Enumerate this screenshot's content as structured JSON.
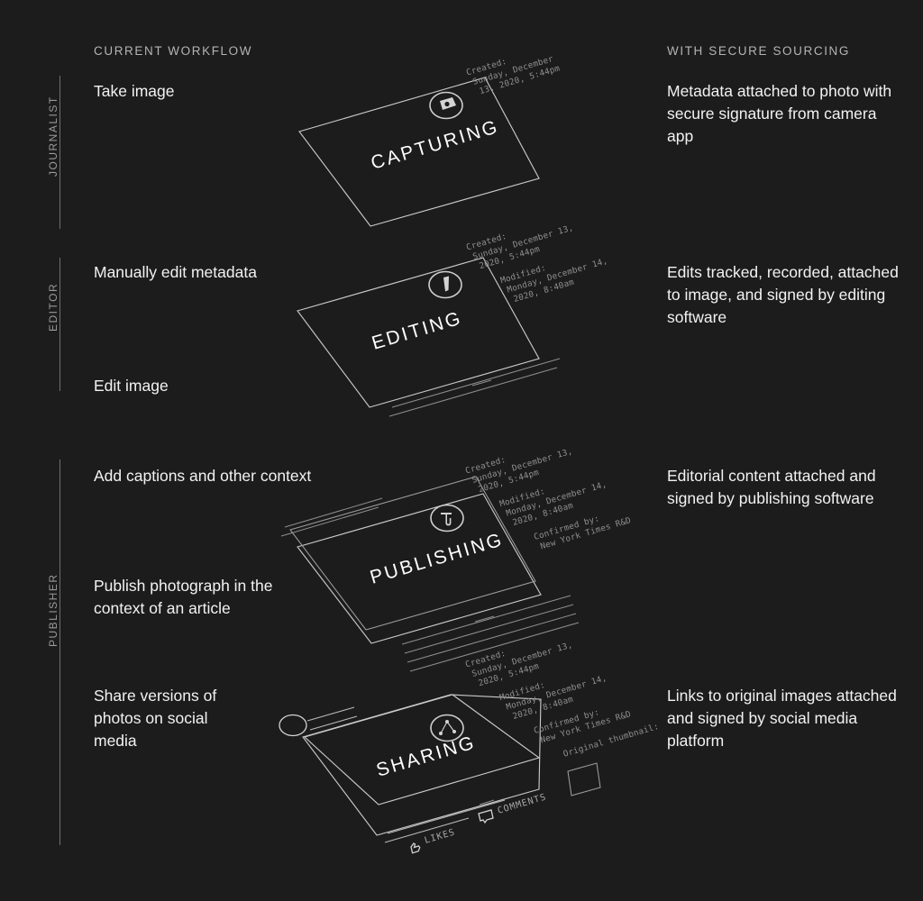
{
  "background_color": "#1c1c1c",
  "columns": {
    "left_header": "CURRENT WORKFLOW",
    "right_header": "WITH SECURE SOURCING"
  },
  "roles": [
    {
      "label": "JOURNALIST"
    },
    {
      "label": "EDITOR"
    },
    {
      "label": "PUBLISHER"
    }
  ],
  "steps": [
    {
      "id": "capturing",
      "stage_label": "CAPTURING",
      "icon": "camera-icon",
      "left_text": "Take image",
      "right_text": "Metadata attached to photo with secure signature from camera app",
      "metadata": [
        {
          "label": "Created:",
          "lines": [
            "Sunday, December",
            "13, 2020, 5:44pm"
          ]
        }
      ]
    },
    {
      "id": "editing",
      "stage_label": "EDITING",
      "icon": "edit-pen-icon",
      "left_text": "Manually edit metadata",
      "left_text_secondary": "Edit image",
      "right_text": "Edits tracked, recorded, attached to image, and signed by editing software",
      "metadata": [
        {
          "label": "Created:",
          "lines": [
            "Sunday, December 13,",
            "2020, 5:44pm"
          ]
        },
        {
          "label": "Modified:",
          "lines": [
            "Monday, December 14,",
            "2020, 8:40am"
          ]
        }
      ]
    },
    {
      "id": "publishing",
      "stage_label": "PUBLISHING",
      "icon": "nyt-t-logo-icon",
      "left_text": "Add captions and other context",
      "left_text_secondary": "Publish photograph in the context of an article",
      "right_text": "Editorial content attached and signed by publishing software",
      "metadata": [
        {
          "label": "Created:",
          "lines": [
            "Sunday, December 13,",
            "2020, 5:44pm"
          ]
        },
        {
          "label": "Modified:",
          "lines": [
            "Monday, December 14,",
            "2020, 8:40am"
          ]
        },
        {
          "label": "Confirmed by:",
          "lines": [
            "New York Times R&D"
          ]
        }
      ]
    },
    {
      "id": "sharing",
      "stage_label": "SHARING",
      "icon": "share-network-icon",
      "left_text": "Share versions of photos on social media",
      "right_text": "Links to original images attached and signed by social media platform",
      "metadata": [
        {
          "label": "Created:",
          "lines": [
            "Sunday, December 13,",
            "2020, 5:44pm"
          ]
        },
        {
          "label": "Modified:",
          "lines": [
            "Monday, December 14,",
            "2020, 8:40am"
          ]
        },
        {
          "label": "Confirmed by:",
          "lines": [
            "New York Times R&D"
          ]
        },
        {
          "label": "Original thumbnail:",
          "lines": []
        }
      ],
      "social": {
        "likes_label": "LIKES",
        "likes_icon": "thumbs-up-icon",
        "comments_label": "COMMENTS",
        "comments_icon": "comment-bubble-icon",
        "avatar_icon": "avatar-circle-icon"
      }
    }
  ]
}
